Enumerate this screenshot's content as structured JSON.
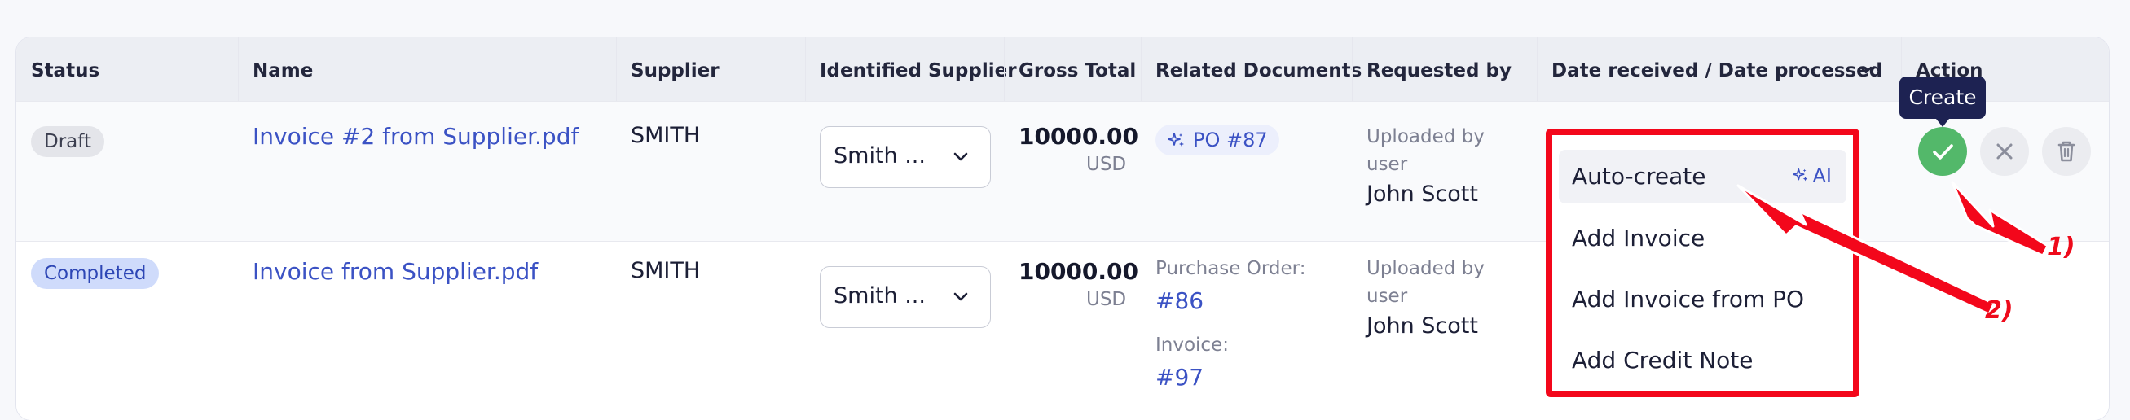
{
  "columns": {
    "status": "Status",
    "name": "Name",
    "supplier": "Supplier",
    "identified_supplier": "Identified Supplier",
    "gross_total": "Gross Total",
    "related_documents": "Related Documents",
    "requested_by": "Requested by",
    "dates": "Date received / Date processed",
    "action": "Action"
  },
  "rows": [
    {
      "status": "Draft",
      "name": "Invoice #2 from Supplier.pdf",
      "supplier": "SMITH",
      "identified_supplier": "Smith ...",
      "amount": "10000.00",
      "currency": "USD",
      "related_chip": "PO #87",
      "uploaded_line1": "Uploaded by",
      "uploaded_line2": "user",
      "requester": "John Scott"
    },
    {
      "status": "Completed",
      "name": "Invoice from Supplier.pdf",
      "supplier": "SMITH",
      "identified_supplier": "Smith ...",
      "amount": "10000.00",
      "currency": "USD",
      "po_label": "Purchase Order:",
      "po_link": "#86",
      "invoice_label": "Invoice:",
      "invoice_link": "#97",
      "uploaded_line1": "Uploaded by",
      "uploaded_line2": "user",
      "requester": "John Scott"
    }
  ],
  "menu": {
    "items": [
      "Auto-create",
      "Add Invoice",
      "Add Invoice from PO",
      "Add Credit Note"
    ],
    "ai_label": "AI"
  },
  "tooltip": "Create",
  "annotations": {
    "one": "1)",
    "two": "2)"
  },
  "colors": {
    "accent": "#3b52c4",
    "annotation": "#f3071b",
    "confirm": "#53b86a"
  }
}
